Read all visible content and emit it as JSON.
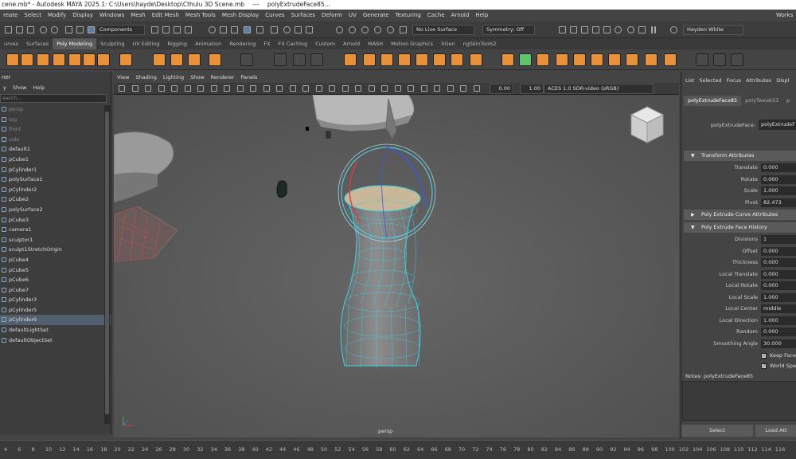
{
  "title_bar": {
    "app_title": "cene.mb* - Autodesk MAYA 2025.1: C:\\Users\\hayde\\Desktop\\Cthulu 3D Scene.mb",
    "separator": "---",
    "node_title": "polyExtrudeFace85..."
  },
  "menus": [
    "reate",
    "Select",
    "Modify",
    "Display",
    "Windows",
    "Mesh",
    "Edit Mesh",
    "Mesh Tools",
    "Mesh Display",
    "Curves",
    "Surfaces",
    "Deform",
    "UV",
    "Generate",
    "Texturing",
    "Cache",
    "Arnold",
    "Help"
  ],
  "workspace_label": "Works",
  "status_line": {
    "selection_mode": "Components",
    "live_surface": "No Live Surface",
    "symmetry": "Symmetry: Off",
    "user": "Hayden White"
  },
  "shelf_tabs": [
    "urves",
    "Surfaces",
    "Poly Modeling",
    "Sculpting",
    "UV Editing",
    "Rigging",
    "Animation",
    "Rendering",
    "FX",
    "FX Caching",
    "Custom",
    "Arnold",
    "MASH",
    "Motion Graphics",
    "XGen",
    "ngSkinTools2"
  ],
  "active_shelf_tab": "Poly Modeling",
  "outliner": {
    "header": "ner",
    "menu": [
      "y",
      "Show",
      "Help"
    ],
    "search_placeholder": "earch...",
    "items": [
      {
        "label": "persp",
        "dim": true
      },
      {
        "label": "top",
        "dim": true
      },
      {
        "label": "front",
        "dim": true
      },
      {
        "label": "side",
        "dim": true
      },
      {
        "label": "default1",
        "dim": false
      },
      {
        "label": "pCube1",
        "dim": false
      },
      {
        "label": "pCylinder1",
        "dim": false
      },
      {
        "label": "polySurface1",
        "dim": false
      },
      {
        "label": "pCylinder2",
        "dim": false
      },
      {
        "label": "pCube2",
        "dim": false
      },
      {
        "label": "polySurface2",
        "dim": false
      },
      {
        "label": "pCube3",
        "dim": false
      },
      {
        "label": "camera1",
        "dim": false
      },
      {
        "label": "sculptor1",
        "dim": false
      },
      {
        "label": "sculpt1StretchOrigin",
        "dim": false
      },
      {
        "label": "pCube4",
        "dim": false
      },
      {
        "label": "pCube5",
        "dim": false
      },
      {
        "label": "pCube6",
        "dim": false
      },
      {
        "label": "pCube7",
        "dim": false
      },
      {
        "label": "pCylinder3",
        "dim": false
      },
      {
        "label": "pCylinder5",
        "dim": false
      },
      {
        "label": "pCylinder6",
        "dim": false,
        "selected": true
      },
      {
        "label": "defaultLightSet",
        "dim": false
      },
      {
        "label": "defaultObjectSet",
        "dim": false
      }
    ]
  },
  "viewport": {
    "menu": [
      "View",
      "Shading",
      "Lighting",
      "Show",
      "Renderer",
      "Panels"
    ],
    "field_a": "0.00",
    "field_b": "1.00",
    "color_space": "ACES 1.0 SDR-video (sRGB)",
    "camera_label": "persp"
  },
  "attribute_editor": {
    "menu": [
      "List",
      "Selected",
      "Focus",
      "Attributes",
      "Displ"
    ],
    "tabs": [
      "polyExtrudeFace85",
      "polyTweak53",
      "p"
    ],
    "node_label": "polyExtrudeFace:",
    "node_value": "polyExtrudeF",
    "sections": {
      "transform": "Transform Attributes",
      "curve": "Poly Extrude Curve Attributes",
      "history": "Poly Extrude Face History"
    },
    "transform_rows": [
      {
        "label": "Translate",
        "value": "0.000"
      },
      {
        "label": "Rotate",
        "value": "0.000"
      },
      {
        "label": "Scale",
        "value": "1.000"
      },
      {
        "label": "Pivot",
        "value": "82.473"
      }
    ],
    "history_rows": [
      {
        "label": "Divisions",
        "value": "1"
      },
      {
        "label": "Offset",
        "value": "0.000"
      },
      {
        "label": "Thickness",
        "value": "0.000"
      },
      {
        "label": "Local Translate",
        "value": "0.000"
      },
      {
        "label": "Local Rotate",
        "value": "0.000"
      },
      {
        "label": "Local Scale",
        "value": "1.000"
      },
      {
        "label": "Local Center",
        "value": "middle"
      },
      {
        "label": "Local Direction",
        "value": "1.000"
      },
      {
        "label": "Random",
        "value": "0.000"
      },
      {
        "label": "Smoothing Angle",
        "value": "30.000"
      }
    ],
    "checkboxes": [
      {
        "label": "Keep Face",
        "checked": true
      },
      {
        "label": "World Spa",
        "checked": true
      }
    ],
    "notes": "Notes:  polyExtrudeFace85",
    "select_button": "Select",
    "load_button": "Load Att"
  },
  "timeline_ticks": [
    "4",
    "6",
    "8",
    "10",
    "12",
    "14",
    "16",
    "18",
    "20",
    "22",
    "24",
    "26",
    "28",
    "30",
    "32",
    "34",
    "36",
    "38",
    "40",
    "42",
    "44",
    "46",
    "48",
    "50",
    "52",
    "54",
    "56",
    "58",
    "60",
    "62",
    "64",
    "66",
    "68",
    "70",
    "72",
    "74",
    "76",
    "78",
    "80",
    "82",
    "84",
    "86",
    "88",
    "90",
    "92",
    "94",
    "96",
    "98",
    "100",
    "102",
    "104",
    "106",
    "108",
    "110",
    "112",
    "114",
    "116",
    "118",
    "120"
  ]
}
